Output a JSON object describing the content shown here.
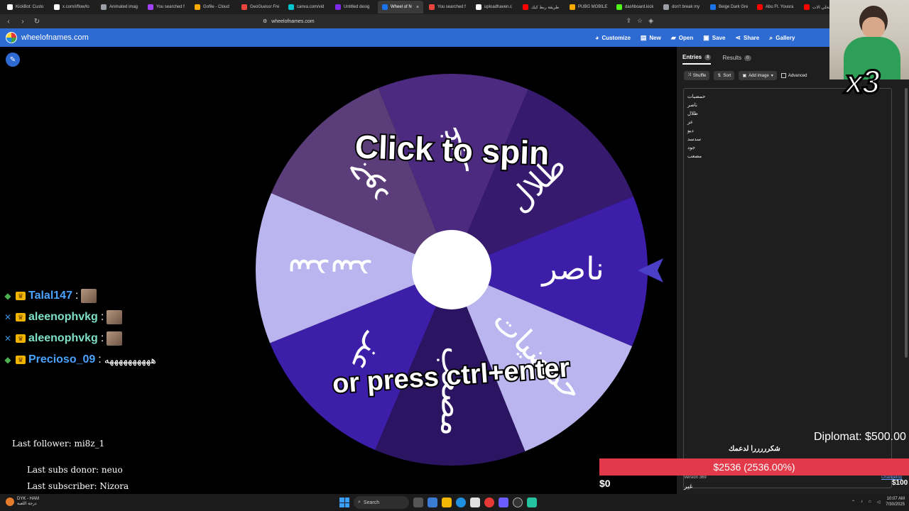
{
  "browser": {
    "tabs": [
      {
        "label": "KickBot: Custo",
        "color": "#ffffff"
      },
      {
        "label": "x.com/i/flow/lo",
        "color": "#ffffff"
      },
      {
        "label": "Animated imag",
        "color": "#9aa0a6"
      },
      {
        "label": "You searched f",
        "color": "#a142f4"
      },
      {
        "label": "Gofile - Cloud",
        "color": "#f9ab00"
      },
      {
        "label": "GeoGuessr Fre",
        "color": "#e8453c"
      },
      {
        "label": "canva.com/vid",
        "color": "#00c4cc"
      },
      {
        "label": "Untitled desig",
        "color": "#7d2ae8"
      },
      {
        "label": "Wheel of N",
        "color": "#1a73e8",
        "active": true
      },
      {
        "label": "You searched f",
        "color": "#e8453c"
      },
      {
        "label": "uploadhaven.c",
        "color": "#ffffff"
      },
      {
        "label": "طريقة ربط كيك",
        "color": "#ff0000"
      },
      {
        "label": "PUBG MOBILE",
        "color": "#f9ab00"
      },
      {
        "label": "dashboard.kick",
        "color": "#53fc18"
      },
      {
        "label": "don't break my",
        "color": "#9aa0a6"
      },
      {
        "label": "Beige Dark Gre",
        "color": "#1a73e8"
      },
      {
        "label": "Abu Ft. Yousra",
        "color": "#ff0000"
      },
      {
        "label": "كيف تخلي الات",
        "color": "#ff0000"
      }
    ],
    "url": "wheelofnames.com"
  },
  "app": {
    "site_name": "wheelofnames.com",
    "nav": [
      {
        "label": "Customize",
        "icon": "palette-icon",
        "glyph": "◕"
      },
      {
        "label": "New",
        "icon": "file-icon",
        "glyph": "▤"
      },
      {
        "label": "Open",
        "icon": "folder-icon",
        "glyph": "▰"
      },
      {
        "label": "Save",
        "icon": "save-icon",
        "glyph": "▣"
      },
      {
        "label": "Share",
        "icon": "share-icon",
        "glyph": "⋖"
      },
      {
        "label": "Gallery",
        "icon": "search-icon",
        "glyph": "⌕"
      }
    ]
  },
  "wheel": {
    "spin_text": "Click to spin",
    "press_text": "or press ctrl+enter",
    "segments": [
      {
        "label": "غير",
        "color": "#4c2a80"
      },
      {
        "label": "طلال",
        "color": "#351a6d"
      },
      {
        "label": "ناصر",
        "color": "#3d1ea8"
      },
      {
        "label": "حمضيات",
        "color": "#bab5ef"
      },
      {
        "label": "مصعب",
        "color": "#2b1462"
      },
      {
        "label": "عز",
        "color": "#3d1ea8"
      },
      {
        "label": "سدسد",
        "color": "#bab5ef"
      },
      {
        "label": "جود",
        "color": "#5b3d7a"
      }
    ],
    "pointer_color": "#4b3fc8"
  },
  "entries_panel": {
    "tabs": [
      {
        "label": "Entries",
        "count": "8",
        "active": true
      },
      {
        "label": "Results",
        "count": "0",
        "active": false
      }
    ],
    "toolbar": {
      "shuffle": "Shuffle",
      "sort": "Sort",
      "add_image": "Add image",
      "advanced": "Advanced"
    },
    "entries": [
      "حمضيات",
      "ناصر",
      "طلال",
      "عز",
      "ديو",
      "سدسد",
      "جود",
      "مصعب"
    ],
    "version": "Version 369",
    "changelog": "Changelog"
  },
  "chat": [
    {
      "name": "Talal147",
      "color": "#4aa3ff",
      "badge": "◆",
      "badge_color": "#4caf50",
      "emote": true,
      "message": ""
    },
    {
      "name": "aleenophvkg",
      "color": "#7fe0c8",
      "badge": "✕",
      "badge_color": "#3b8fd8",
      "emote": true,
      "message": ""
    },
    {
      "name": "aleenophvkg",
      "color": "#7fe0c8",
      "badge": "✕",
      "badge_color": "#3b8fd8",
      "emote": true,
      "message": ""
    },
    {
      "name": "Precioso_09",
      "color": "#4aa3ff",
      "badge": "◆",
      "badge_color": "#4caf50",
      "emote": false,
      "message": "ههههههههههه"
    }
  ],
  "overlay": {
    "last_follower": "Last follower: mi8z_1",
    "last_subs_donor": "Last subs donor: neuo",
    "last_subscriber": "Last subscriber: Nizora",
    "diplomat": "Diplomat: $500.00",
    "thanks": "شكرررررا لدعمك",
    "donation_bar": "$2536 (2536.00%)",
    "amount_low": "$0",
    "amount_high": "$100",
    "ghayr": "غير",
    "x3": "x3"
  },
  "taskbar": {
    "weather_title": "DYK - HAM",
    "weather_sub": "درجة اللعبة",
    "search": "Search",
    "time": "10:07 AM",
    "date": "7/30/2025"
  }
}
